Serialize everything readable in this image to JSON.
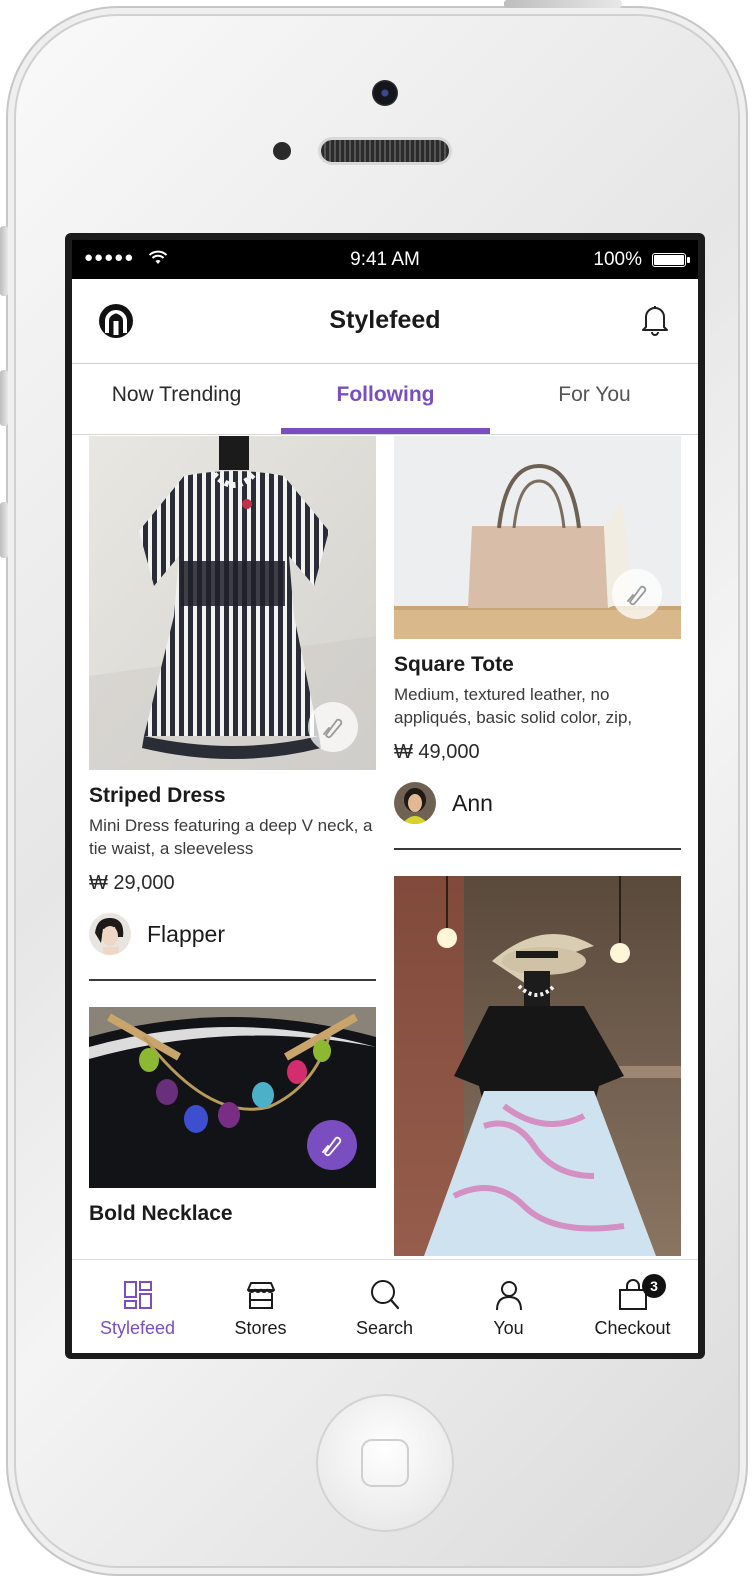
{
  "statusbar": {
    "signal": "●●●●●",
    "time": "9:41 AM",
    "battery": "100%",
    "battery_level": 1.0
  },
  "appbar": {
    "title": "Stylefeed",
    "logo_icon": "brand-logo-icon",
    "notification_icon": "bell-icon"
  },
  "tabs": [
    {
      "label": "Now Trending",
      "active": false
    },
    {
      "label": "Following",
      "active": true
    },
    {
      "label": "For You",
      "active": false
    }
  ],
  "feed": {
    "left": [
      {
        "title": "Striped Dress",
        "description": "Mini Dress featuring a deep V neck, a tie waist, a sleeveless",
        "price": "₩ 29,000",
        "author": "Flapper",
        "pinned": false
      },
      {
        "title": "Bold Necklace",
        "pinned": true
      }
    ],
    "right": [
      {
        "title": "Square Tote",
        "description": "Medium, textured leather, no appliqués, basic solid color, zip,",
        "price": "₩ 49,000",
        "author": "Ann",
        "pinned": false
      },
      {
        "pinned": false
      }
    ]
  },
  "bottomnav": [
    {
      "label": "Stylefeed",
      "icon": "grid-icon",
      "active": true
    },
    {
      "label": "Stores",
      "icon": "store-icon",
      "active": false
    },
    {
      "label": "Search",
      "icon": "search-icon",
      "active": false
    },
    {
      "label": "You",
      "icon": "person-icon",
      "active": false
    },
    {
      "label": "Checkout",
      "icon": "bag-icon",
      "badge": "3",
      "active": false
    }
  ],
  "colors": {
    "accent": "#7a4ec0",
    "text": "#1b1b1b"
  }
}
